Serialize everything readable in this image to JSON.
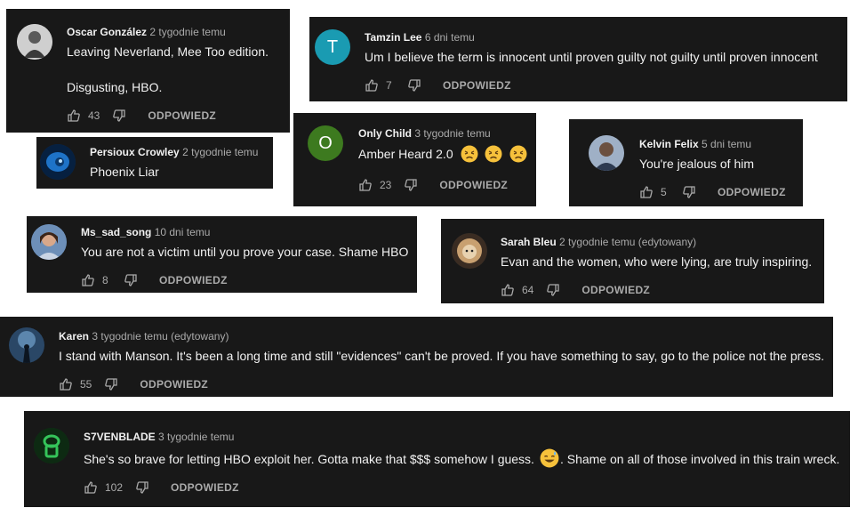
{
  "ui": {
    "reply_label": "ODPOWIEDZ"
  },
  "comments": [
    {
      "author": "Oscar González",
      "time": "2 tygodnie temu",
      "text": "Leaving Neverland, Mee Too edition.",
      "text2": "Disgusting, HBO.",
      "likes": "43"
    },
    {
      "author": "Tamzin Lee",
      "time": "6 dni temu",
      "avatar_letter": "T",
      "avatar_color": "#1a9bb2",
      "text": "Um I believe the term is innocent until proven guilty not guilty until proven innocent",
      "likes": "7"
    },
    {
      "author": "Persioux Crowley",
      "time": "2 tygodnie temu",
      "text": "Phoenix Liar"
    },
    {
      "author": "Only Child",
      "time": "3 tygodnie temu",
      "avatar_letter": "O",
      "avatar_color": "#3d7a1f",
      "text": "Amber Heard 2.0",
      "emoji": "persevering-face",
      "likes": "23"
    },
    {
      "author": "Kelvin Felix",
      "time": "5 dni temu",
      "text": "You're jealous of him",
      "likes": "5"
    },
    {
      "author": "Ms_sad_song",
      "time": "10 dni temu",
      "text": "You are not a victim until you prove your case. Shame HBO",
      "likes": "8"
    },
    {
      "author": "Sarah Bleu",
      "time": "2 tygodnie temu (edytowany)",
      "text": "Evan and the women, who were lying, are truly inspiring.",
      "likes": "64"
    },
    {
      "author": "Karen",
      "time": "3 tygodnie temu (edytowany)",
      "text": "I stand with Manson. It's been a long time and still \"evidences\" can't be proved. If you have something to say, go to the police not the press.",
      "likes": "55"
    },
    {
      "author": "S7VENBLADE",
      "time": "3 tygodnie temu",
      "text": "She's so brave for letting HBO exploit her. Gotta make that $$$ somehow I guess.",
      "text2": ". Shame on all of those involved in this train wreck.",
      "emoji": "grinning-sweat-face",
      "likes": "102"
    }
  ]
}
